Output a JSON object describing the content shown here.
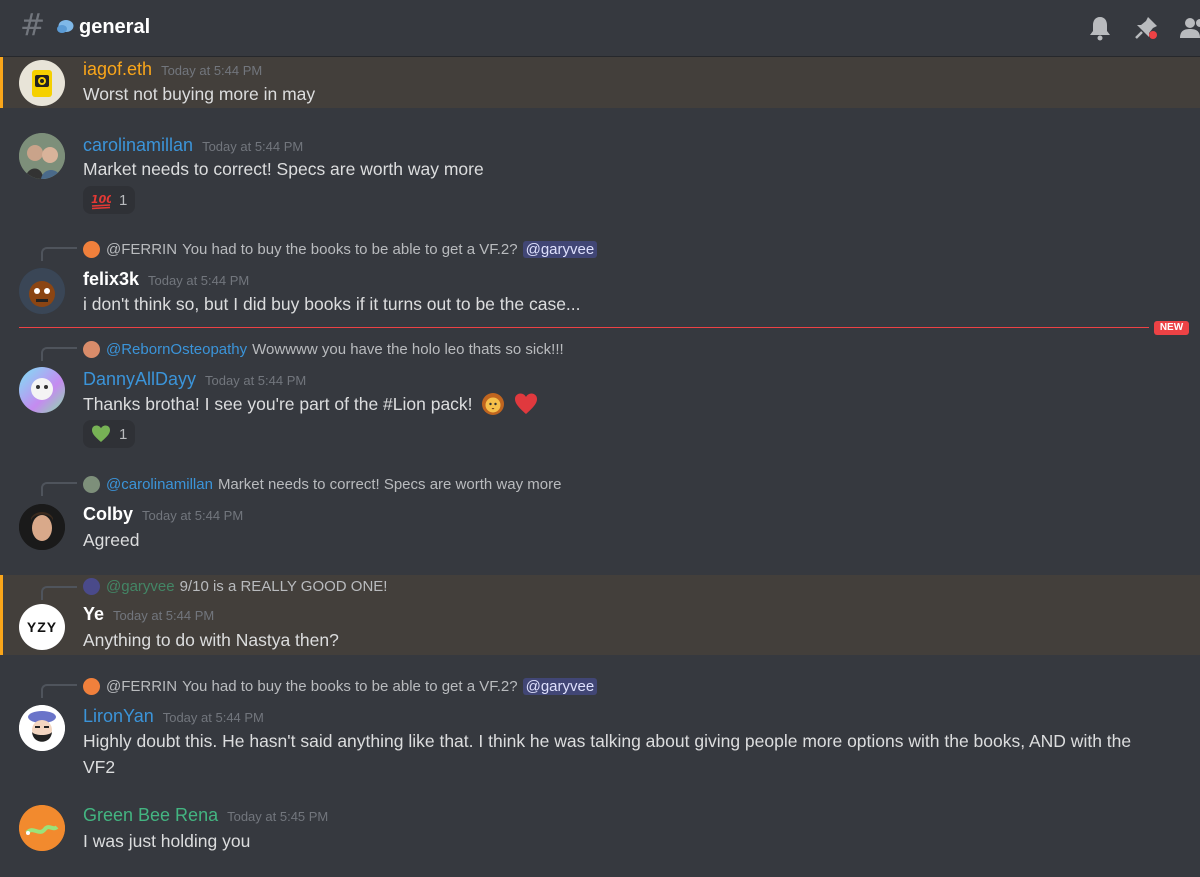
{
  "channel": {
    "name": "general",
    "emoji": "speech-balloon-icon"
  },
  "header_icons": [
    "bell-icon",
    "pin-icon",
    "members-icon"
  ],
  "colors": {
    "highlight_bg": "#433f3b",
    "highlight_bar": "#faa61a",
    "new_line": "#ed4245",
    "mention_bg": "#414675"
  },
  "divider": {
    "label": "NEW"
  },
  "messages": [
    {
      "author": "iagof.eth",
      "author_color": "#faa61a",
      "timestamp": "Today at 5:44 PM",
      "text": "Worst not buying more in may",
      "highlighted": true
    },
    {
      "author": "carolinamillan",
      "author_color": "#3b94d9",
      "timestamp": "Today at 5:44 PM",
      "text": "Market needs to correct! Specs are worth way more",
      "reaction": {
        "emoji": "hundred-points-icon",
        "count": "1"
      }
    },
    {
      "reply": {
        "name": "@FERRIN",
        "text": "You had to buy the books to be able to get a VF.2?",
        "mention": "@garyvee"
      },
      "author": "felix3k",
      "author_color": "#ffffff",
      "timestamp": "Today at 5:44 PM",
      "text": "i don't think so, but I did buy books if it turns out to be the case..."
    },
    {
      "reply": {
        "name": "@RebornOsteopathy",
        "text": "Wowwww you have the holo leo thats so sick!!!"
      },
      "author": "DannyAllDayy",
      "author_color": "#3b94d9",
      "timestamp": "Today at 5:44 PM",
      "text": "Thanks brotha! I see you're part of the #Lion pack!",
      "reaction": {
        "emoji": "green-heart-icon",
        "count": "1"
      }
    },
    {
      "reply": {
        "name": "@carolinamillan",
        "text": "Market needs to correct! Specs are worth way more"
      },
      "author": "Colby",
      "author_color": "#ffffff",
      "timestamp": "Today at 5:44 PM",
      "text": "Agreed"
    },
    {
      "reply": {
        "name": "@garyvee",
        "text": "9/10 is a REALLY GOOD ONE!"
      },
      "author": "Ye",
      "author_color": "#ffffff",
      "timestamp": "Today at 5:44 PM",
      "text": "Anything to do with Nastya then?",
      "highlighted": true,
      "avatar_text": "YZY"
    },
    {
      "reply": {
        "name": "@FERRIN",
        "text": "You had to buy the books to be able to get a VF.2?",
        "mention": "@garyvee"
      },
      "author": "LironYan",
      "author_color": "#3b94d9",
      "timestamp": "Today at 5:44 PM",
      "text": "Highly doubt this. He hasn't said anything like that. I think he was talking about giving people more options with the books, AND with the VF2"
    },
    {
      "author": "Green Bee Rena",
      "author_color": "#43b581",
      "timestamp": "Today at 5:45 PM",
      "text": "I was just holding you"
    }
  ]
}
